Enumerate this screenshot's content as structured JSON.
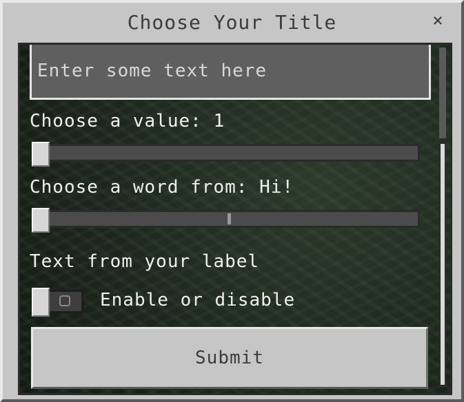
{
  "dialog": {
    "title": "Choose Your Title",
    "close_label": "×"
  },
  "form": {
    "text_input": {
      "placeholder": "Enter some text here",
      "value": ""
    },
    "value_slider": {
      "label": "Choose a value: 1",
      "value": 1,
      "position_fraction": 0.0
    },
    "word_slider": {
      "label": "Choose a word from: Hi!",
      "selected_word": "Hi!",
      "position_fraction": 0.0
    },
    "static_label": "Text from your label",
    "toggle": {
      "label": "Enable or disable",
      "state": "off"
    },
    "submit_label": "Submit"
  },
  "colors": {
    "panel": "#c6c6c6",
    "text_dark": "#3b3b3b",
    "text_light": "#f0f0f0"
  }
}
